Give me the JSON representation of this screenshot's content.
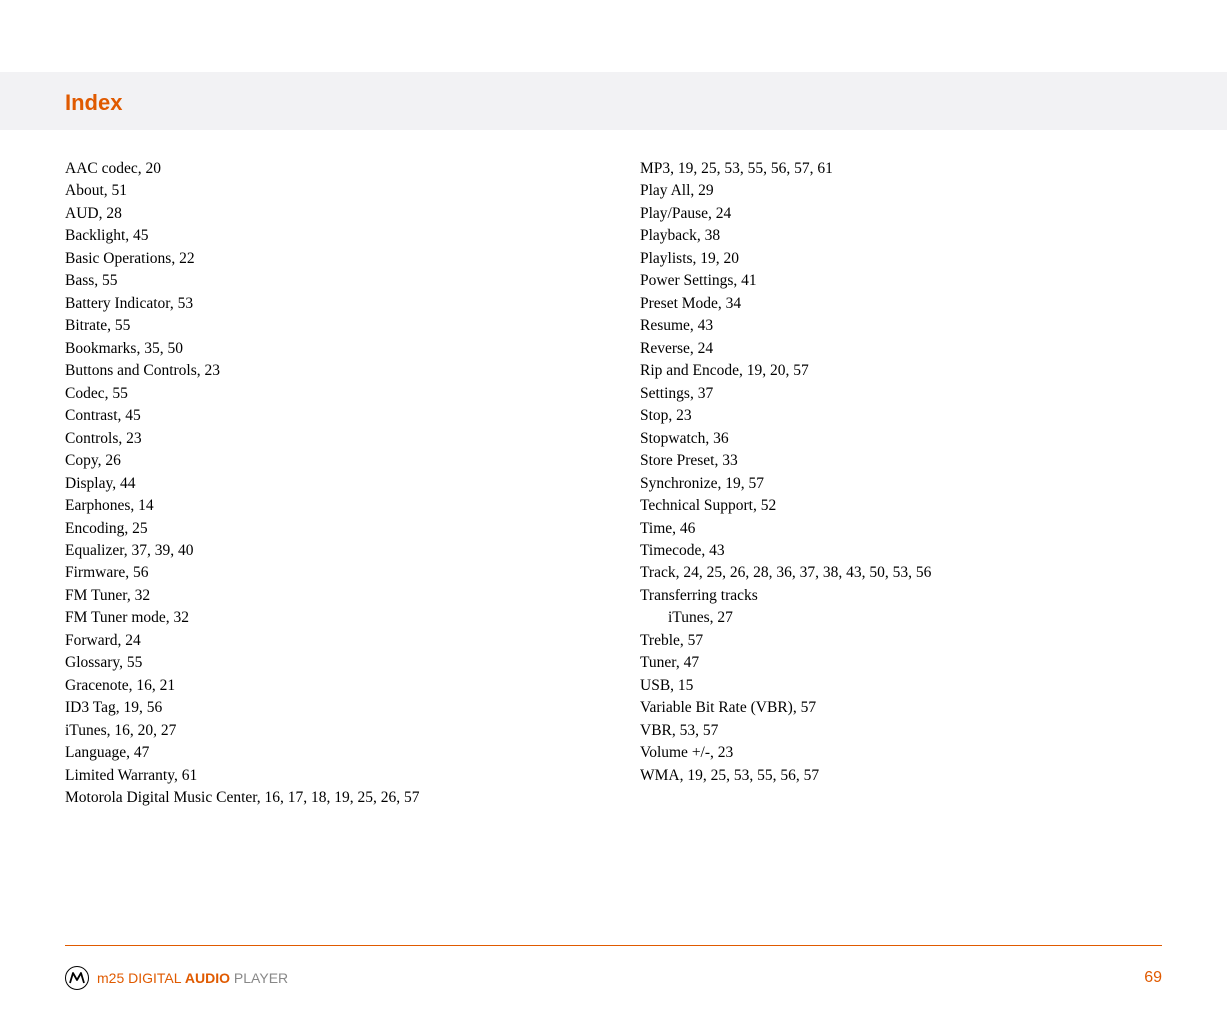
{
  "header": {
    "title": "Index"
  },
  "columns": {
    "left": [
      {
        "text": "AAC codec, 20"
      },
      {
        "text": "About, 51"
      },
      {
        "text": "AUD, 28"
      },
      {
        "text": "Backlight, 45"
      },
      {
        "text": "Basic Operations, 22"
      },
      {
        "text": "Bass, 55"
      },
      {
        "text": "Battery Indicator, 53"
      },
      {
        "text": "Bitrate, 55"
      },
      {
        "text": "Bookmarks, 35, 50"
      },
      {
        "text": "Buttons and Controls, 23"
      },
      {
        "text": "Codec, 55"
      },
      {
        "text": "Contrast, 45"
      },
      {
        "text": "Controls, 23"
      },
      {
        "text": "Copy, 26"
      },
      {
        "text": "Display, 44"
      },
      {
        "text": "Earphones, 14"
      },
      {
        "text": "Encoding, 25"
      },
      {
        "text": "Equalizer, 37, 39, 40"
      },
      {
        "text": "Firmware, 56"
      },
      {
        "text": "FM Tuner, 32"
      },
      {
        "text": "FM Tuner mode, 32"
      },
      {
        "text": "Forward, 24"
      },
      {
        "text": "Glossary, 55"
      },
      {
        "text": "Gracenote, 16, 21"
      },
      {
        "text": "ID3 Tag, 19, 56"
      },
      {
        "text": "iTunes, 16, 20, 27"
      },
      {
        "text": "Language, 47"
      },
      {
        "text": "Limited Warranty, 61"
      },
      {
        "text": "Motorola Digital Music Center, 16, 17, 18, 19, 25, 26, 57"
      }
    ],
    "right": [
      {
        "text": "MP3, 19, 25, 53, 55, 56, 57, 61"
      },
      {
        "text": "Play All, 29"
      },
      {
        "text": "Play/Pause, 24"
      },
      {
        "text": "Playback, 38"
      },
      {
        "text": "Playlists, 19, 20"
      },
      {
        "text": "Power Settings, 41"
      },
      {
        "text": "Preset Mode, 34"
      },
      {
        "text": "Resume, 43"
      },
      {
        "text": "Reverse, 24"
      },
      {
        "text": "Rip and Encode, 19, 20, 57"
      },
      {
        "text": "Settings, 37"
      },
      {
        "text": "Stop, 23"
      },
      {
        "text": "Stopwatch, 36"
      },
      {
        "text": "Store Preset, 33"
      },
      {
        "text": "Synchronize, 19, 57"
      },
      {
        "text": "Technical Support, 52"
      },
      {
        "text": "Time, 46"
      },
      {
        "text": "Timecode, 43"
      },
      {
        "text": "Track, 24, 25, 26, 28, 36, 37, 38, 43, 50, 53, 56"
      },
      {
        "text": "Transferring tracks"
      },
      {
        "text": "iTunes, 27",
        "sub": true
      },
      {
        "text": "Treble, 57"
      },
      {
        "text": "Tuner, 47"
      },
      {
        "text": "USB, 15"
      },
      {
        "text": "Variable Bit Rate (VBR), 57"
      },
      {
        "text": "VBR, 53, 57"
      },
      {
        "text": "Volume +/-, 23"
      },
      {
        "text": "WMA, 19, 25, 53, 55, 56, 57"
      }
    ]
  },
  "footer": {
    "product_prefix": "m25 DIGITAL ",
    "product_bold": "AUDIO",
    "product_suffix": " PLAYER",
    "page": "69"
  }
}
